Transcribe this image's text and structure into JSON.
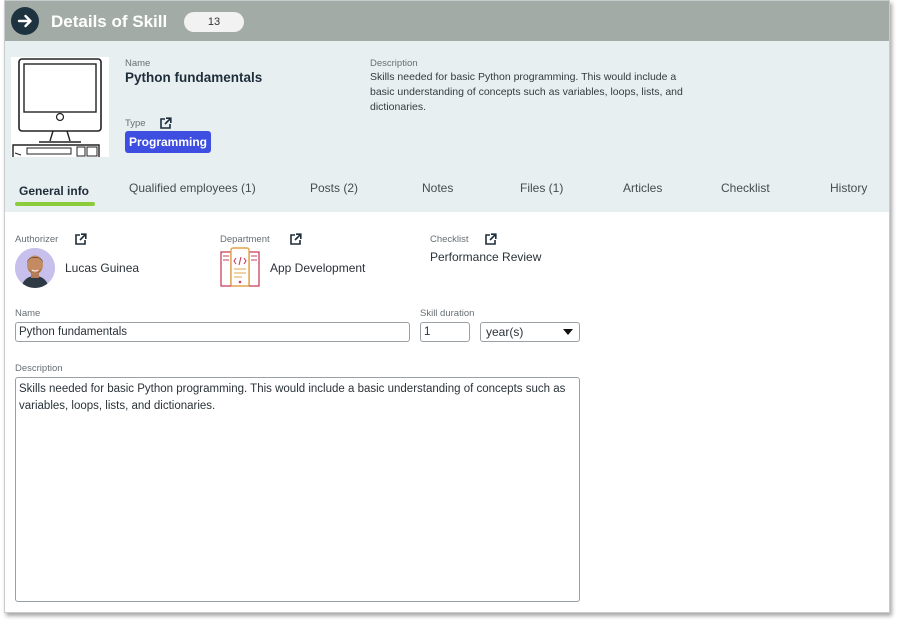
{
  "header": {
    "title": "Details of Skill",
    "count": "13",
    "back_icon": "arrow-right-icon"
  },
  "summary": {
    "name_label": "Name",
    "name": "Python fundamentals",
    "type_label": "Type",
    "type_value": "Programming",
    "description_label": "Description",
    "description": "Skills needed for basic Python programming. This would include a basic understanding of concepts such as variables, loops, lists, and dictionaries.",
    "image_icon": "desktop-computer-icon"
  },
  "tabs": [
    {
      "label": "General info",
      "active": true
    },
    {
      "label": "Qualified employees (1)"
    },
    {
      "label": "Posts (2)"
    },
    {
      "label": "Notes"
    },
    {
      "label": "Files (1)"
    },
    {
      "label": "Articles"
    },
    {
      "label": "Checklist"
    },
    {
      "label": "History"
    }
  ],
  "general": {
    "authorizer_label": "Authorizer",
    "authorizer_name": "Lucas Guinea",
    "department_label": "Department",
    "department_name": "App Development",
    "checklist_label": "Checklist",
    "checklist_name": "Performance Review",
    "name_label": "Name",
    "name_value": "Python fundamentals",
    "duration_label": "Skill duration",
    "duration_value": "1",
    "duration_unit": "year(s)",
    "description_label": "Description",
    "description_value": "Skills needed for basic Python programming. This would include a basic understanding of concepts such as variables, loops, lists, and dictionaries."
  },
  "colors": {
    "header_bg": "#a3aba6",
    "summary_bg": "#e8eff1",
    "type_badge": "#3d4ee0",
    "active_tab_underline": "#8ccc3a",
    "back_button": "#1e3340"
  }
}
